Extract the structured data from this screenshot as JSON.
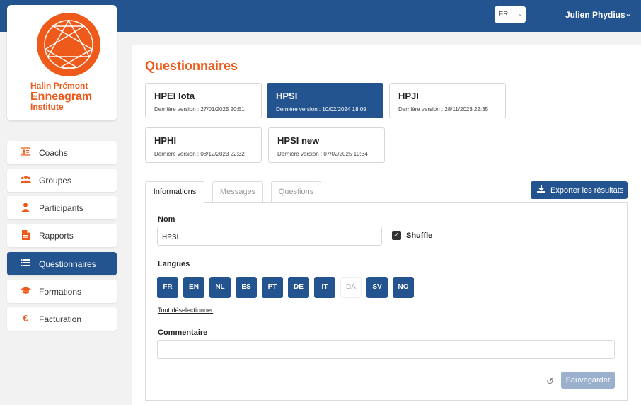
{
  "header": {
    "language": "FR",
    "user_name": "Julien Phydius"
  },
  "logo": {
    "line1": "Halin Prémont",
    "line2": "Enneagram",
    "line3": "Institute",
    "color": "#ee5a1a"
  },
  "sidebar": {
    "items": [
      {
        "label": "Coachs",
        "icon": "id-card-icon"
      },
      {
        "label": "Groupes",
        "icon": "users-icon"
      },
      {
        "label": "Participants",
        "icon": "user-icon"
      },
      {
        "label": "Rapports",
        "icon": "file-icon"
      },
      {
        "label": "Questionnaires",
        "icon": "list-icon",
        "active": true
      },
      {
        "label": "Formations",
        "icon": "graduation-cap-icon"
      },
      {
        "label": "Facturation",
        "icon": "euro-icon"
      }
    ]
  },
  "page": {
    "title": "Questionnaires"
  },
  "questionnaires": [
    {
      "name": "HPEI Iota",
      "version": "Dernière version : 27/01/2025 20:51"
    },
    {
      "name": "HPSI",
      "version": "Dernière version : 10/02/2024 18:09",
      "selected": true
    },
    {
      "name": "HPJI",
      "version": "Dernière version : 28/11/2023 22:35"
    },
    {
      "name": "HPHI",
      "version": "Dernière version : 08/12/2023 22:32"
    },
    {
      "name": "HPSI new",
      "version": "Dernière version : 07/02/2025 10:34"
    }
  ],
  "tabs": [
    {
      "label": "Informations",
      "active": true
    },
    {
      "label": "Messages"
    },
    {
      "label": "Questions"
    }
  ],
  "export_button": "Exporter les résultats",
  "form": {
    "nom_label": "Nom",
    "nom_value": "HPSI",
    "shuffle_label": "Shuffle",
    "shuffle_checked": true,
    "langues_label": "Langues",
    "languages": [
      {
        "code": "FR",
        "selected": true
      },
      {
        "code": "EN",
        "selected": true
      },
      {
        "code": "NL",
        "selected": true
      },
      {
        "code": "ES",
        "selected": true
      },
      {
        "code": "PT",
        "selected": true
      },
      {
        "code": "DE",
        "selected": true
      },
      {
        "code": "IT",
        "selected": true
      },
      {
        "code": "DA",
        "selected": false
      },
      {
        "code": "SV",
        "selected": true
      },
      {
        "code": "NO",
        "selected": true
      }
    ],
    "deselect_all": "Tout déselectionner",
    "commentaire_label": "Commentaire",
    "commentaire_value": "",
    "save_button": "Sauvegarder"
  },
  "colors": {
    "primary": "#24548f",
    "accent": "#ee5a1a",
    "disabled_button": "#9bb0cc"
  }
}
